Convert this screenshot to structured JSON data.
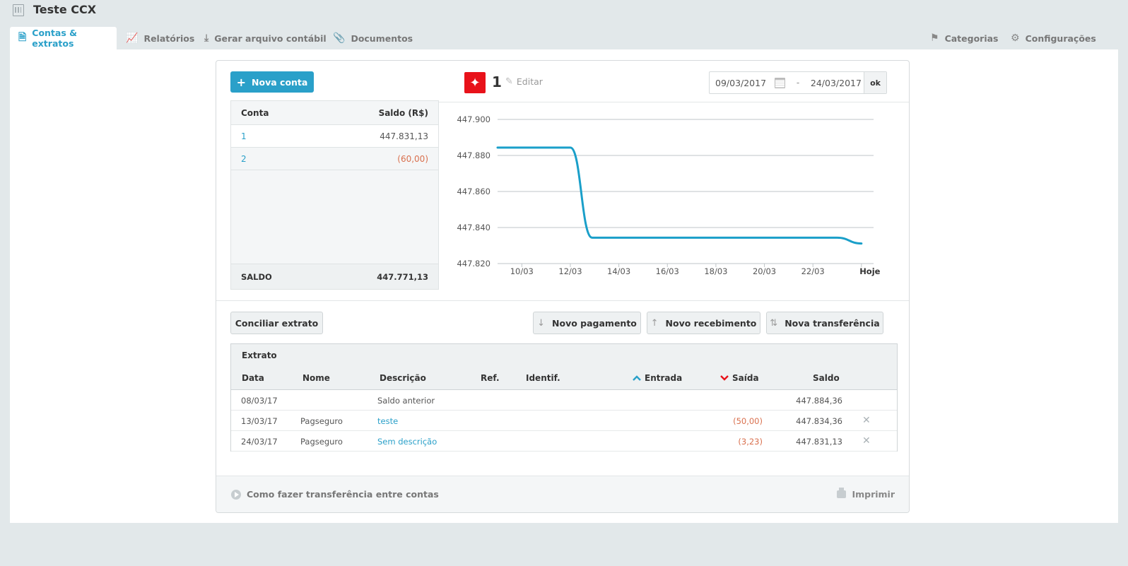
{
  "app": {
    "title": "Teste CCX"
  },
  "tabs": [
    {
      "label": "Contas & extratos",
      "icon": "document-icon",
      "active": true
    },
    {
      "label": "Relatórios",
      "icon": "line-chart-icon"
    },
    {
      "label": "Gerar arquivo contábil",
      "icon": "download-icon"
    },
    {
      "label": "Documentos",
      "icon": "paperclip-icon"
    }
  ],
  "tabs_right": [
    {
      "label": "Categorias",
      "icon": "tags-icon"
    },
    {
      "label": "Configurações",
      "icon": "gear-icon"
    }
  ],
  "toolbar": {
    "new_account_label": "Nova conta",
    "account_number": "1",
    "edit_label": "Editar",
    "date_from": "09/03/2017",
    "date_sep": "-",
    "date_to": "24/03/2017",
    "ok_label": "ok"
  },
  "accounts": {
    "header": {
      "col1": "Conta",
      "col2": "Saldo (R$)"
    },
    "rows": [
      {
        "name": "1",
        "balance": "447.831,13",
        "negative": false
      },
      {
        "name": "2",
        "balance": "(60,00)",
        "negative": true
      }
    ],
    "footer": {
      "label": "SALDO",
      "value": "447.771,13"
    }
  },
  "chart_data": {
    "type": "line",
    "x_ticks": [
      "10/03",
      "12/03",
      "14/03",
      "16/03",
      "18/03",
      "20/03",
      "22/03",
      "Hoje"
    ],
    "y_ticks": [
      "447.900",
      "447.880",
      "447.860",
      "447.840",
      "447.820"
    ],
    "ylim": [
      447820,
      447900
    ],
    "xlim": [
      9,
      24.5
    ],
    "series": [
      {
        "color": "#1a9fc9",
        "points": [
          [
            9,
            447884.36
          ],
          [
            12,
            447884.36
          ],
          [
            12.9,
            447834.36
          ],
          [
            23,
            447834.36
          ],
          [
            24,
            447831.13
          ]
        ]
      }
    ]
  },
  "actions": {
    "reconcile": "Conciliar extrato",
    "new_payment": "Novo pagamento",
    "new_receipt": "Novo recebimento",
    "new_transfer": "Nova transferência"
  },
  "extrato": {
    "title": "Extrato",
    "columns": {
      "date": "Data",
      "name": "Nome",
      "desc": "Descrição",
      "ref": "Ref.",
      "ident": "Identif.",
      "in": "Entrada",
      "out": "Saída",
      "balance": "Saldo"
    },
    "rows": [
      {
        "date": "08/03/17",
        "name": "",
        "desc": "Saldo anterior",
        "desc_link": false,
        "out": "",
        "balance": "447.884,36",
        "deletable": false
      },
      {
        "date": "13/03/17",
        "name": "Pagseguro",
        "desc": "teste",
        "desc_link": true,
        "out": "(50,00)",
        "balance": "447.834,36",
        "deletable": true
      },
      {
        "date": "24/03/17",
        "name": "Pagseguro",
        "desc": "Sem descrição",
        "desc_link": true,
        "out": "(3,23)",
        "balance": "447.831,13",
        "deletable": true
      }
    ]
  },
  "footer": {
    "help_label": "Como fazer transferência entre contas",
    "print_label": "Imprimir"
  },
  "colors": {
    "accent": "#2aa0c9",
    "negative": "#d9704e",
    "bank": "#e8121a",
    "up_arrow": "#2aa0c9",
    "down_arrow": "#e8121a"
  }
}
